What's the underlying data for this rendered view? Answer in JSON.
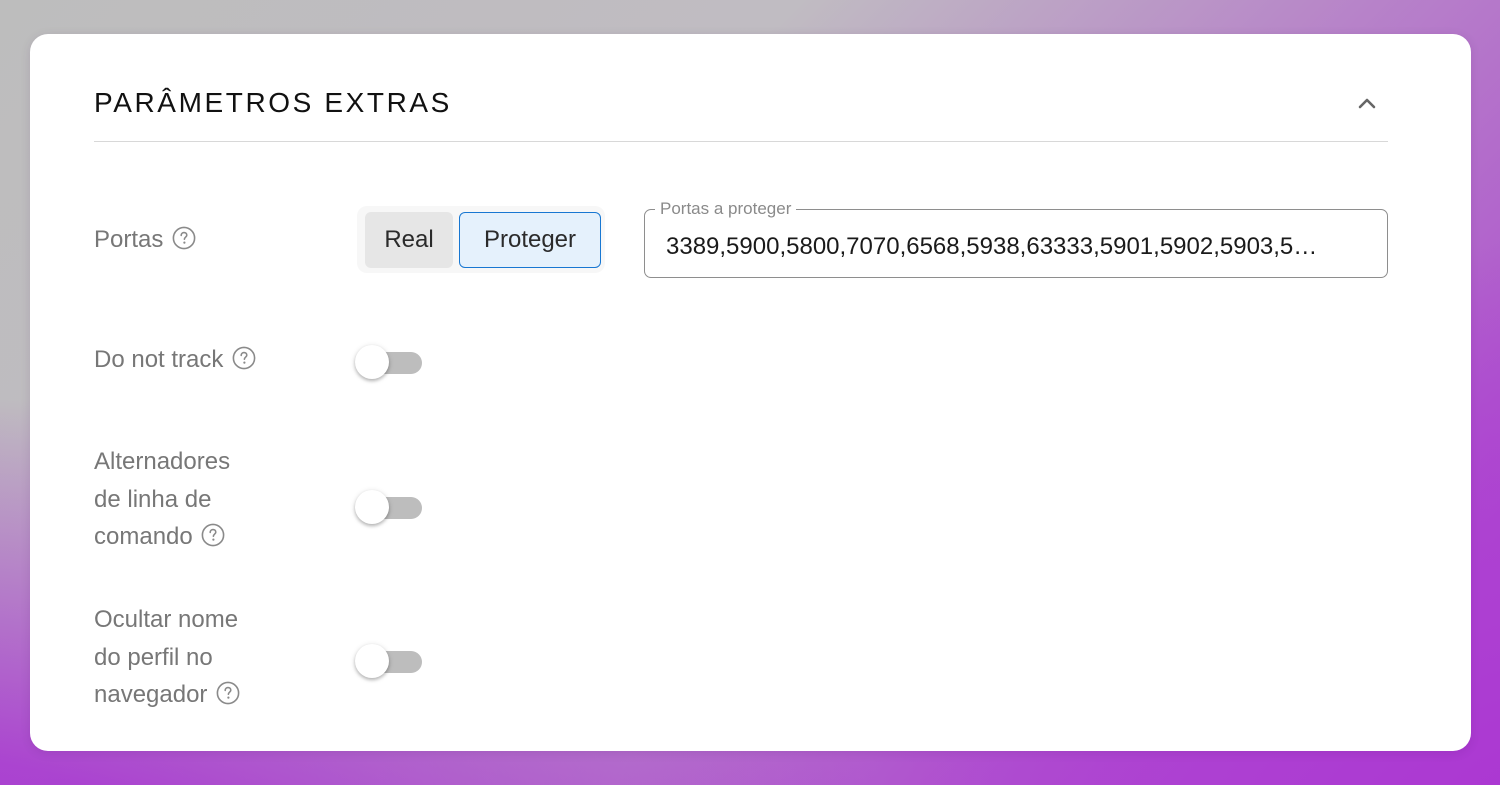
{
  "section": {
    "title": "PARÂMETROS EXTRAS",
    "collapse_icon": "chevron-up-icon"
  },
  "ports": {
    "label": "Portas",
    "help_icon": "question-circle-icon",
    "modes": [
      "Real",
      "Proteger"
    ],
    "selected_mode": "Proteger",
    "field_label": "Portas a proteger",
    "field_value": "3389,5900,5800,7070,6568,5938,63333,5901,5902,5903,5…"
  },
  "toggles": [
    {
      "label_lines": [
        "Do not track"
      ],
      "on": false
    },
    {
      "label_lines": [
        "Alternadores",
        "de linha de",
        "comando"
      ],
      "on": false
    },
    {
      "label_lines": [
        "Ocultar nome",
        "do perfil no",
        "navegador"
      ],
      "on": false
    }
  ],
  "colors": {
    "accent": "#1877d2",
    "selected_bg": "#e5f1fc",
    "toggle_off_track": "#bdbdbd",
    "label_text": "#777777"
  }
}
